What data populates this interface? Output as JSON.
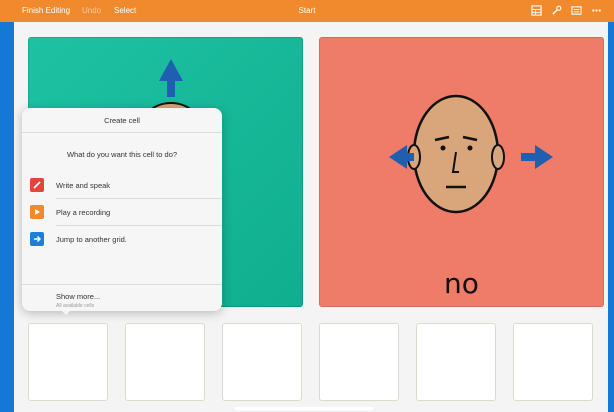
{
  "toolbar": {
    "finish_label": "Finish Editing",
    "undo_label": "Undo",
    "select_label": "Select",
    "title": "Start"
  },
  "cells": {
    "red_label": "no"
  },
  "popover": {
    "title": "Create cell",
    "question": "What do you want this cell to do?",
    "options": [
      {
        "label": "Write and speak",
        "color": "#e0473b",
        "icon": "pencil-icon"
      },
      {
        "label": "Play a recording",
        "color": "#f08a2c",
        "icon": "play-icon"
      },
      {
        "label": "Jump to another grid.",
        "color": "#1f7fd6",
        "icon": "arrow-right-icon"
      }
    ],
    "show_more": "Show more...",
    "show_more_sub": "All available cells"
  },
  "colors": {
    "toolbar": "#f08a2c",
    "teal_cell": "#1ec2a3",
    "red_cell": "#ee7c68",
    "arrow_blue": "#1f5fb0"
  }
}
